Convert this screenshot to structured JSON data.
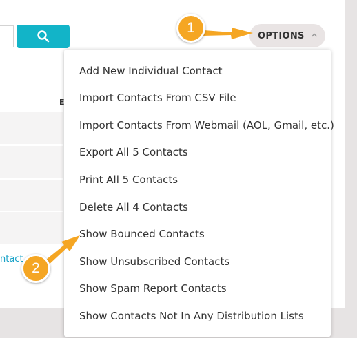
{
  "search": {
    "button_icon": "search-icon"
  },
  "table": {
    "column_header_partial": "E",
    "link_partial": "ntact"
  },
  "options": {
    "label": "OPTIONS",
    "caret_icon": "chevron-up-icon"
  },
  "menu": {
    "items": [
      {
        "label": "Add New Individual Contact"
      },
      {
        "label": "Import Contacts From CSV File"
      },
      {
        "label": "Import Contacts From Webmail (AOL, Gmail, etc.)"
      },
      {
        "label": "Export All 5 Contacts"
      },
      {
        "label": "Print All 5 Contacts"
      },
      {
        "label": "Delete All 4 Contacts"
      },
      {
        "label": "Show Bounced Contacts"
      },
      {
        "label": "Show Unsubscribed Contacts"
      },
      {
        "label": "Show Spam Report Contacts"
      },
      {
        "label": "Show Contacts Not In Any Distribution Lists"
      }
    ]
  },
  "annotations": {
    "step1": "1",
    "step2": "2",
    "color": "#f5a623"
  },
  "colors": {
    "accent": "#12b4c8",
    "link": "#1aa3c8"
  }
}
